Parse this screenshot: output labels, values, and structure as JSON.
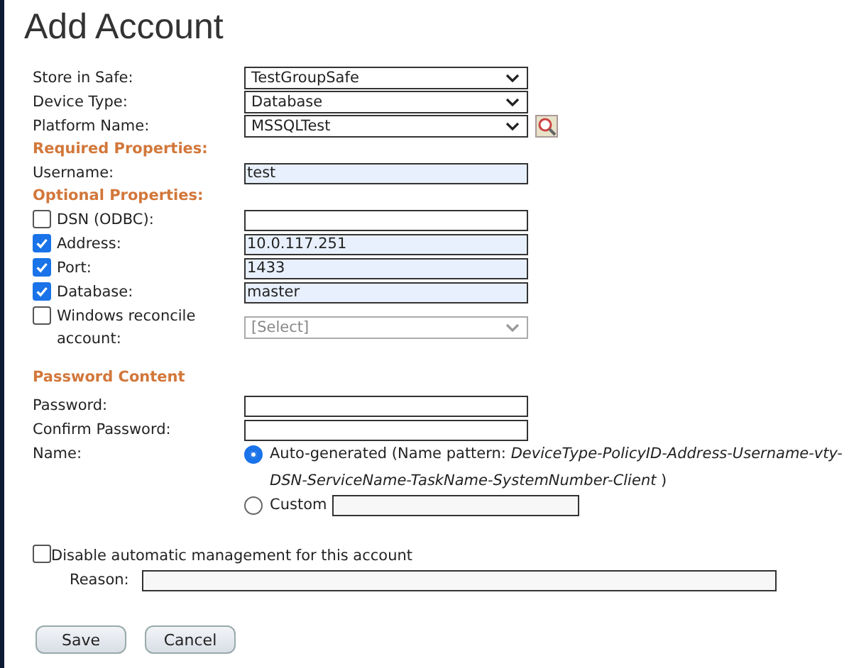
{
  "title": "Add Account",
  "fields": [
    {
      "kind": "select",
      "label": "Store in Safe:",
      "value": "TestGroupSafe"
    },
    {
      "kind": "lookup_select",
      "label": "Device Type:",
      "value": "Database"
    },
    {
      "kind": "lookup_select",
      "label": "Platform Name:",
      "value": "MSSQLTest",
      "lookup": true
    },
    {
      "kind": "heading",
      "label": "Required Properties:"
    },
    {
      "kind": "text",
      "label": "Username:",
      "value": "test"
    },
    {
      "kind": "heading",
      "label": "Optional Properties:"
    },
    {
      "kind": "check_text",
      "label": "DSN (ODBC):",
      "checked": false
    },
    {
      "kind": "check_text",
      "label": "Address:",
      "checked": true,
      "value": "10.0.117.251"
    },
    {
      "kind": "check_text",
      "label": "Port:",
      "checked": true,
      "value": "1433"
    },
    {
      "kind": "check_text",
      "label": "Database:",
      "checked": true,
      "value": "master"
    },
    {
      "kind": "check_select",
      "label": "Windows reconcile account:",
      "checked": false,
      "value": "[Select]",
      "disabled": true
    }
  ],
  "password": {
    "heading": "Password Content",
    "fields": [
      {
        "label": "Password:"
      },
      {
        "label": "Confirm Password:"
      }
    ],
    "name_label": "Name:",
    "name_options": [
      {
        "label": "Auto-generated (Name pattern: *DeviceType-PolicyID-Address-Username-vty-DSN-ServiceName-TaskName-SystemNumber-Client* )",
        "selected": true,
        "kind": "plain"
      },
      {
        "label": "Custom",
        "selected": false,
        "kind": "with_input"
      }
    ]
  },
  "disable": {
    "label": "Disable automatic management for this account",
    "checked": false,
    "reason_label": "Reason:"
  },
  "buttons": [
    "Save",
    "Cancel"
  ]
}
